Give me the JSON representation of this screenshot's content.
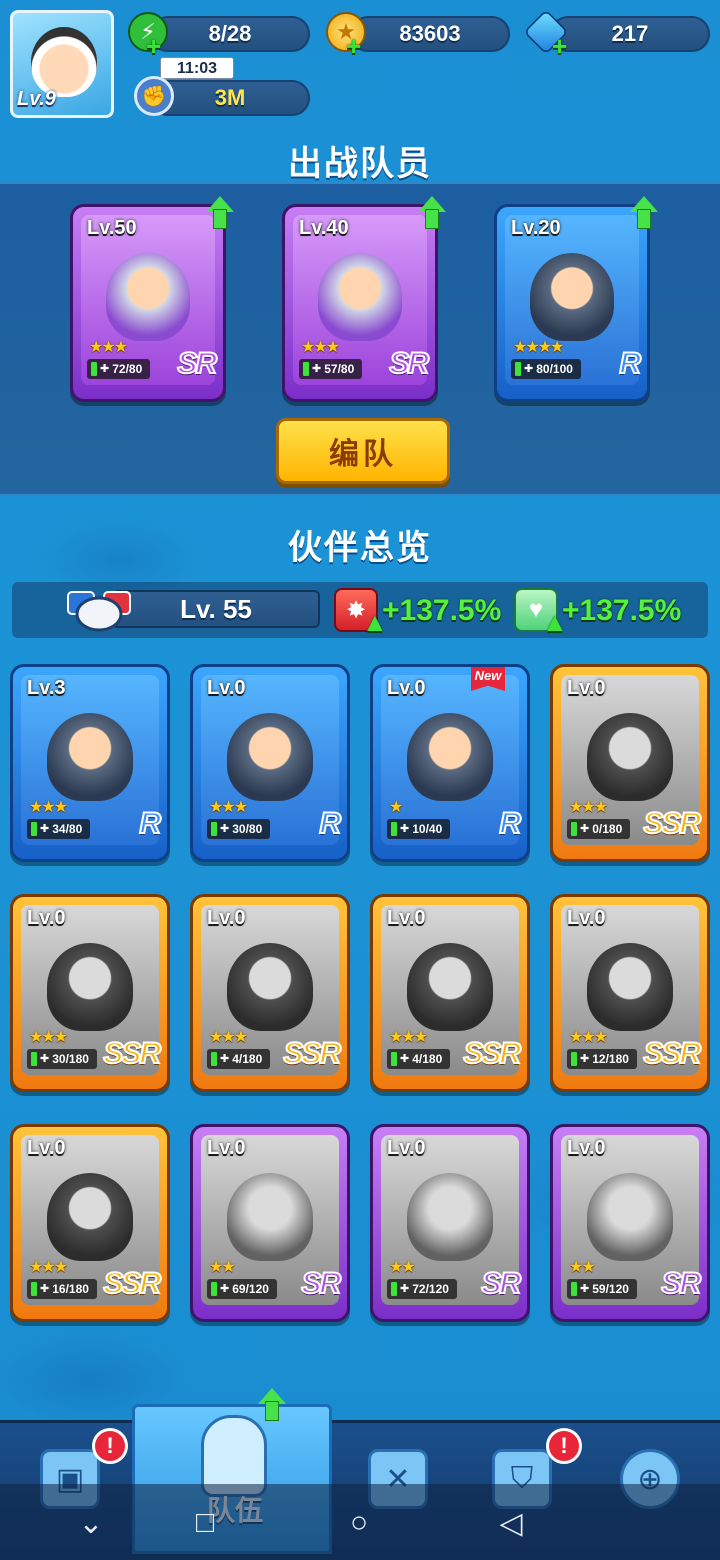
{
  "player": {
    "level": "Lv.9"
  },
  "resources": {
    "stamina": "8/28",
    "timer": "11:03",
    "coins": "83603",
    "gems": "217",
    "power": "3M"
  },
  "battle_section": {
    "title": "出战队员",
    "cards": [
      {
        "level": "Lv.50",
        "stars": "★★★",
        "shards": "72/80",
        "rarity": "SR",
        "frame": "purple",
        "shard_fill": 0.9
      },
      {
        "level": "Lv.40",
        "stars": "★★★",
        "shards": "57/80",
        "rarity": "SR",
        "frame": "purple",
        "shard_fill": 0.71
      },
      {
        "level": "Lv.20",
        "stars": "★★★★",
        "shards": "80/100",
        "rarity": "R",
        "frame": "blue",
        "shard_fill": 0.8
      }
    ],
    "formation_button": "编队"
  },
  "overview_section": {
    "title": "伙伴总览",
    "team_level": "Lv. 55",
    "attack_bonus": "+137.5%",
    "hp_bonus": "+137.5%"
  },
  "partners": [
    {
      "level": "Lv.3",
      "stars": "★★★",
      "shards": "34/80",
      "rarity": "R",
      "frame": "blue",
      "owned": true
    },
    {
      "level": "Lv.0",
      "stars": "★★★",
      "shards": "30/80",
      "rarity": "R",
      "frame": "blue",
      "owned": true
    },
    {
      "level": "Lv.0",
      "stars": "★",
      "shards": "10/40",
      "rarity": "R",
      "frame": "blue",
      "owned": true,
      "badge": "New"
    },
    {
      "level": "Lv.0",
      "stars": "★★★",
      "shards": "0/180",
      "rarity": "SSR",
      "frame": "orange",
      "owned": false
    },
    {
      "level": "Lv.0",
      "stars": "★★★",
      "shards": "30/180",
      "rarity": "SSR",
      "frame": "orange",
      "owned": false
    },
    {
      "level": "Lv.0",
      "stars": "★★★",
      "shards": "4/180",
      "rarity": "SSR",
      "frame": "orange",
      "owned": false
    },
    {
      "level": "Lv.0",
      "stars": "★★★",
      "shards": "4/180",
      "rarity": "SSR",
      "frame": "orange",
      "owned": false
    },
    {
      "level": "Lv.0",
      "stars": "★★★",
      "shards": "12/180",
      "rarity": "SSR",
      "frame": "orange",
      "owned": false
    },
    {
      "level": "Lv.0",
      "stars": "★★★",
      "shards": "16/180",
      "rarity": "SSR",
      "frame": "orange",
      "owned": false
    },
    {
      "level": "Lv.0",
      "stars": "★★",
      "shards": "69/120",
      "rarity": "SR",
      "frame": "purple",
      "owned": false
    },
    {
      "level": "Lv.0",
      "stars": "★★",
      "shards": "72/120",
      "rarity": "SR",
      "frame": "purple",
      "owned": false
    },
    {
      "level": "Lv.0",
      "stars": "★★",
      "shards": "59/120",
      "rarity": "SR",
      "frame": "purple",
      "owned": false
    }
  ],
  "bottom_nav": {
    "active_tab_label": "队伍",
    "alert_mark": "!"
  },
  "colors": {
    "bg": "#1a8fd1",
    "accent_green": "#54f23c",
    "button_yellow": "#ffc21a",
    "alert_red": "#e8263a"
  }
}
